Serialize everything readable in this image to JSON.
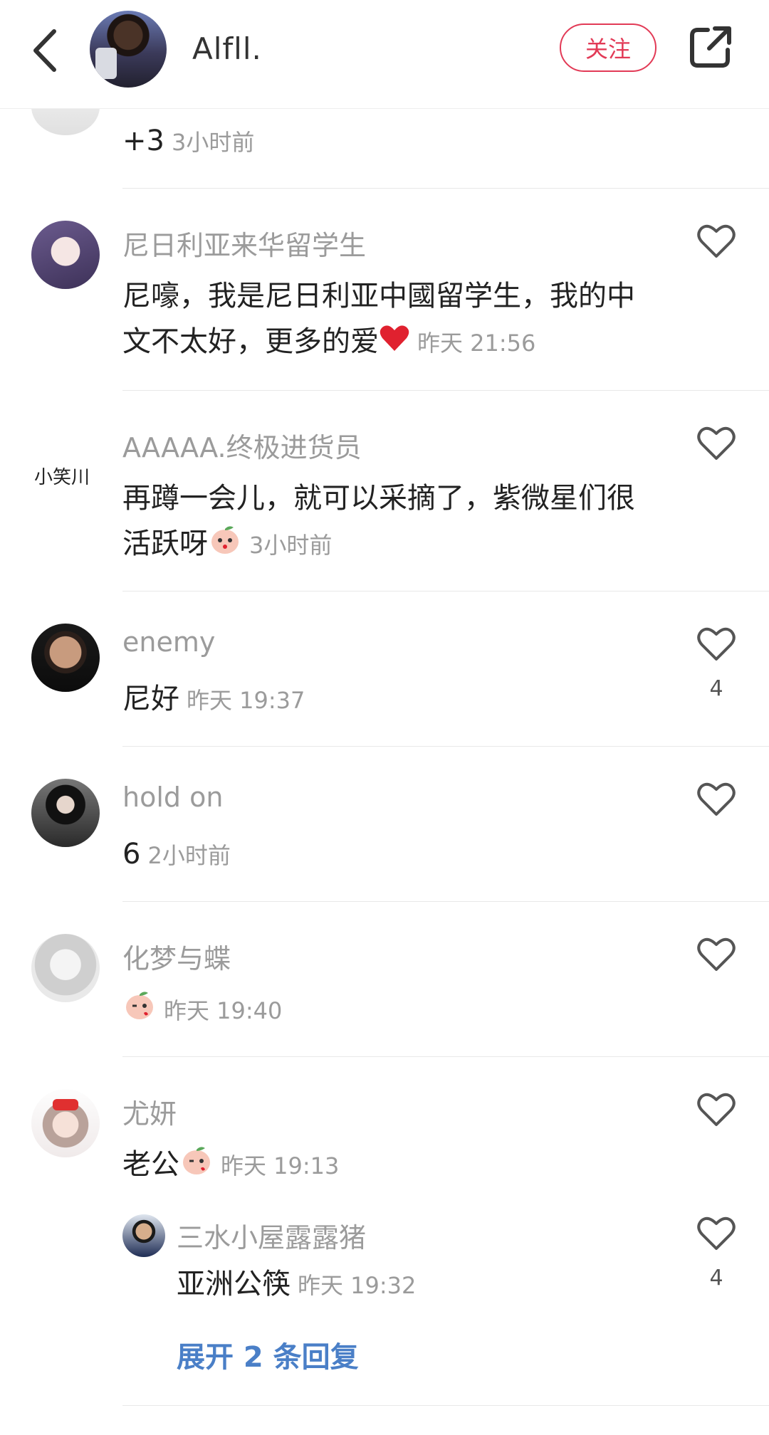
{
  "header": {
    "title": "Alfll.",
    "follow_label": "关注"
  },
  "comments": [
    {
      "username": "",
      "text": "+3",
      "time": "3小时前"
    },
    {
      "username": "尼日利亚来华留学生",
      "text": "尼嚎，我是尼日利亚中國留学生，我的中文不太好，更多的爱",
      "time": "昨天 21:56"
    },
    {
      "username": "AAAAA.终极进货员",
      "text": "再蹲一会儿，就可以采摘了，紫微星们很活跃呀",
      "time": "3小时前",
      "avatar_text": "小笑川"
    },
    {
      "username": "enemy",
      "text": "尼好",
      "time": "昨天 19:37",
      "likes": "4"
    },
    {
      "username": "hold on",
      "text": "6",
      "time": "2小时前"
    },
    {
      "username": "化梦与蝶",
      "text": "",
      "time": "昨天 19:40"
    },
    {
      "username": "尤妍",
      "text": "老公",
      "time": "昨天 19:13"
    }
  ],
  "reply": {
    "username": "三水小屋露露猪",
    "text": "亚洲公筷",
    "time": "昨天 19:32",
    "likes": "4"
  },
  "expand_label": "展开 2 条回复",
  "colors": {
    "accent": "#e23a56",
    "link": "#4a7fc7",
    "muted": "#9b9b9b"
  }
}
